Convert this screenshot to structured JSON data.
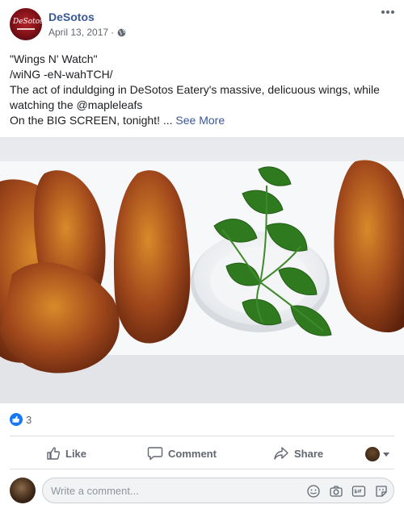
{
  "post": {
    "page_name": "DeSotos",
    "date": "April 13, 2017",
    "meta_separator": "·",
    "avatar_text": "DeSotos",
    "lines": [
      "\"Wings N' Watch\"",
      "/wiNG -eN-wahTCH/",
      "The act of induldging in DeSotos Eatery's massive, delicuous wings, while watching the @mapleleafs",
      "On the BIG SCREEN, tonight! ..."
    ],
    "see_more": "See More"
  },
  "reactions": {
    "count": "3"
  },
  "actions": {
    "like": "Like",
    "comment": "Comment",
    "share": "Share"
  },
  "comment": {
    "placeholder": "Write a comment..."
  },
  "icons": {
    "globe": "globe-icon",
    "more": "more-options-icon",
    "like": "thumbs-up-icon",
    "comment": "speech-bubble-icon",
    "share": "share-arrow-icon",
    "emoji": "smiley-icon",
    "camera": "camera-icon",
    "gif": "gif-icon",
    "sticker": "sticker-icon"
  },
  "colors": {
    "link": "#385898",
    "like_blue": "#1877f2",
    "text": "#1c1e21",
    "muted": "#606770"
  }
}
